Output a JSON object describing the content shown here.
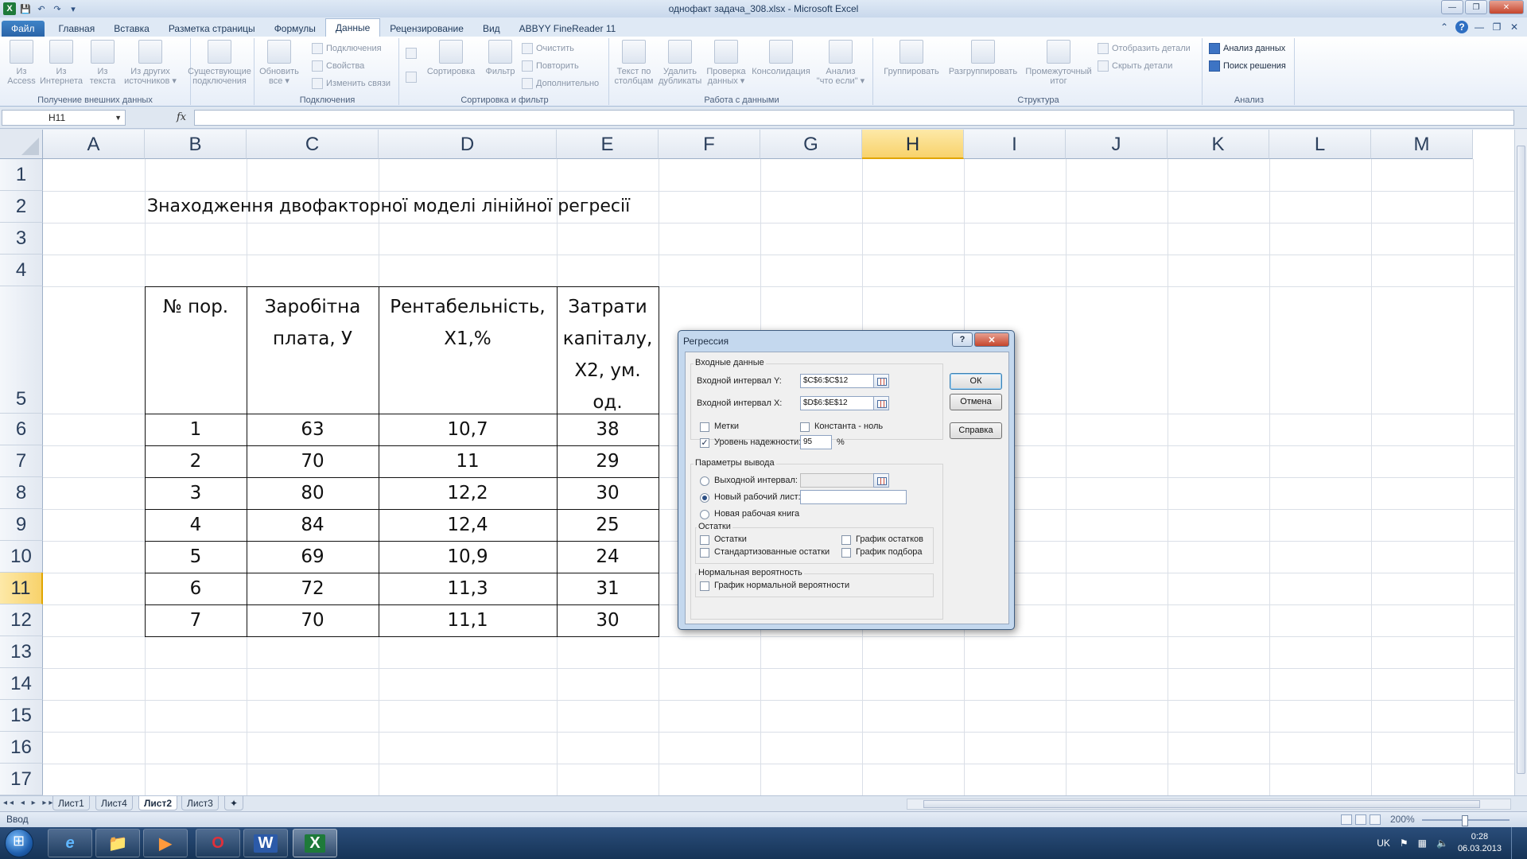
{
  "window": {
    "title": "однофакт задача_308.xlsx  -  Microsoft Excel",
    "app_icon": "excel-icon",
    "controls": {
      "minimize": "—",
      "restore": "❐",
      "close": "✕"
    }
  },
  "qat": {
    "save": "💾",
    "undo": "↶",
    "redo": "↷",
    "customize": "▾"
  },
  "tabs": [
    {
      "label": "Файл"
    },
    {
      "label": "Главная"
    },
    {
      "label": "Вставка"
    },
    {
      "label": "Разметка страницы"
    },
    {
      "label": "Формулы"
    },
    {
      "label": "Данные"
    },
    {
      "label": "Рецензирование"
    },
    {
      "label": "Вид"
    },
    {
      "label": "ABBYY FineReader 11"
    }
  ],
  "ribbon": {
    "groups": {
      "external": "Получение внешних данных",
      "connections": "Подключения",
      "sortfilter": "Сортировка и фильтр",
      "datatools": "Работа с данными",
      "outline": "Структура",
      "analysis": "Анализ"
    },
    "external": {
      "access": [
        "Из",
        "Access"
      ],
      "web": [
        "Из",
        "Интернета"
      ],
      "text": [
        "Из",
        "текста"
      ],
      "other": [
        "Из других",
        "источников ▾"
      ],
      "existing": [
        "Существующие",
        "подключения"
      ]
    },
    "connections": {
      "refresh": [
        "Обновить",
        "все ▾"
      ],
      "conn": "Подключения",
      "props": "Свойства",
      "links": "Изменить связи"
    },
    "sortfilter": {
      "sort": "Сортировка",
      "filter": "Фильтр",
      "clear": "Очистить",
      "reapply": "Повторить",
      "advanced": "Дополнительно"
    },
    "datatools": {
      "text_to_cols": [
        "Текст по",
        "столбцам"
      ],
      "remove_dup": [
        "Удалить",
        "дубликаты"
      ],
      "validation": [
        "Проверка",
        "данных ▾"
      ],
      "consolidate": "Консолидация",
      "whatif": [
        "Анализ",
        "\"что если\" ▾"
      ]
    },
    "outline": {
      "group": "Группировать",
      "ungroup": "Разгруппировать",
      "subtotal": [
        "Промежуточный",
        "итог"
      ],
      "show": "Отобразить детали",
      "hide": "Скрыть детали"
    },
    "analysis": {
      "data_analysis": "Анализ данных",
      "solver": "Поиск решения"
    }
  },
  "formula_bar": {
    "name_box": "H11",
    "fx": "fx",
    "formula": ""
  },
  "grid": {
    "columns": [
      "A",
      "B",
      "C",
      "D",
      "E",
      "F",
      "G",
      "H",
      "I",
      "J",
      "K",
      "L",
      "M"
    ],
    "rows": [
      "1",
      "2",
      "3",
      "4",
      "5",
      "6",
      "7",
      "8",
      "9",
      "10",
      "11",
      "12",
      "13",
      "14",
      "15",
      "16",
      "17"
    ],
    "selected_column": "H",
    "selected_row": "11",
    "title": "Знаходження двофакторної моделі лінійної регресії",
    "table_headers": [
      [
        "№ пор."
      ],
      [
        "Заробітна",
        "плата, У"
      ],
      [
        "Рентабельність,",
        "Х1,%"
      ],
      [
        "Затрати",
        "капіталу,",
        "Х2, ум.",
        "од."
      ]
    ],
    "table_rows": [
      [
        "1",
        "63",
        "10,7",
        "38"
      ],
      [
        "2",
        "70",
        "11",
        "29"
      ],
      [
        "3",
        "80",
        "12,2",
        "30"
      ],
      [
        "4",
        "84",
        "12,4",
        "25"
      ],
      [
        "5",
        "69",
        "10,9",
        "24"
      ],
      [
        "6",
        "72",
        "11,3",
        "31"
      ],
      [
        "7",
        "70",
        "11,1",
        "30"
      ]
    ]
  },
  "sheets": {
    "nav": "◂◂ ◂ ▸ ▸▸",
    "tabs": [
      {
        "label": "Лист1",
        "active": false
      },
      {
        "label": "Лист4",
        "active": false
      },
      {
        "label": "Лист2",
        "active": true
      },
      {
        "label": "Лист3",
        "active": false
      }
    ]
  },
  "status": {
    "mode": "Ввод",
    "zoom": "200%"
  },
  "taskbar": {
    "apps": [
      {
        "name": "ie-icon",
        "glyph": "e",
        "color": "#5fb7ff"
      },
      {
        "name": "explorer-icon",
        "glyph": "📁",
        "color": "#f2c94c"
      },
      {
        "name": "media-player-icon",
        "glyph": "▶",
        "color": "#ff9a3c"
      },
      {
        "name": "opera-icon",
        "glyph": "O",
        "color": "#e0303a"
      },
      {
        "name": "word-icon",
        "glyph": "W",
        "color": "#2b5aa8"
      },
      {
        "name": "excel-icon",
        "glyph": "X",
        "color": "#1e7a3a"
      }
    ],
    "lang": "UK",
    "time": "0:28",
    "date": "06.03.2013"
  },
  "dialog": {
    "title": "Регрессия",
    "help_btn": "?",
    "close_btn": "✕",
    "input_group": "Входные данные",
    "input_y_label": "Входной интервал Y:",
    "input_y_value": "$C$6:$C$12",
    "input_x_label": "Входной интервал X:",
    "input_x_value": "$D$6:$E$12",
    "labels_label": "Метки",
    "labels_checked": false,
    "const_zero_label": "Константа - ноль",
    "const_zero_checked": false,
    "confidence_label": "Уровень надежности:",
    "confidence_checked": true,
    "confidence_value": "95",
    "percent": "%",
    "output_group": "Параметры вывода",
    "output_range_label": "Выходной интервал:",
    "new_sheet_label": "Новый рабочий лист:",
    "new_book_label": "Новая рабочая книга",
    "output_selected": "new_sheet",
    "residuals_group": "Остатки",
    "residuals_label": "Остатки",
    "std_residuals_label": "Стандартизованные остатки",
    "residual_plots_label": "График остатков",
    "line_fit_label": "График подбора",
    "normal_group": "Нормальная вероятность",
    "normal_plot_label": "График нормальной вероятности",
    "ok": "ОК",
    "cancel": "Отмена",
    "help": "Справка"
  }
}
